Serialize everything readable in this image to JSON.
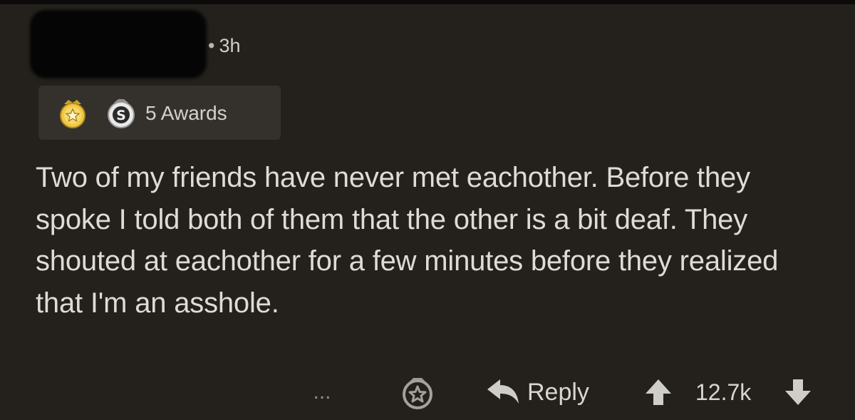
{
  "comment": {
    "timestamp": "3h",
    "awards_label": "5 Awards",
    "body": "Two of my friends have never met eachother. Before they spoke I told both of them that the other is a bit deaf. They shouted at eachother for a few minutes before they realized that I'm an asshole."
  },
  "actions": {
    "more_label": "...",
    "reply_label": "Reply",
    "score": "12.7k"
  },
  "icons": {
    "award_gold": "gold-award-icon",
    "award_silver": "silver-award-icon",
    "give_award": "give-award-icon",
    "reply": "reply-arrow-icon",
    "upvote": "upvote-arrow-icon",
    "downvote": "downvote-arrow-icon"
  },
  "colors": {
    "background": "#24211c",
    "chip_background": "#34312c",
    "text": "#dedcd6",
    "muted": "#8f8d87",
    "gold": "#e8b93a"
  }
}
